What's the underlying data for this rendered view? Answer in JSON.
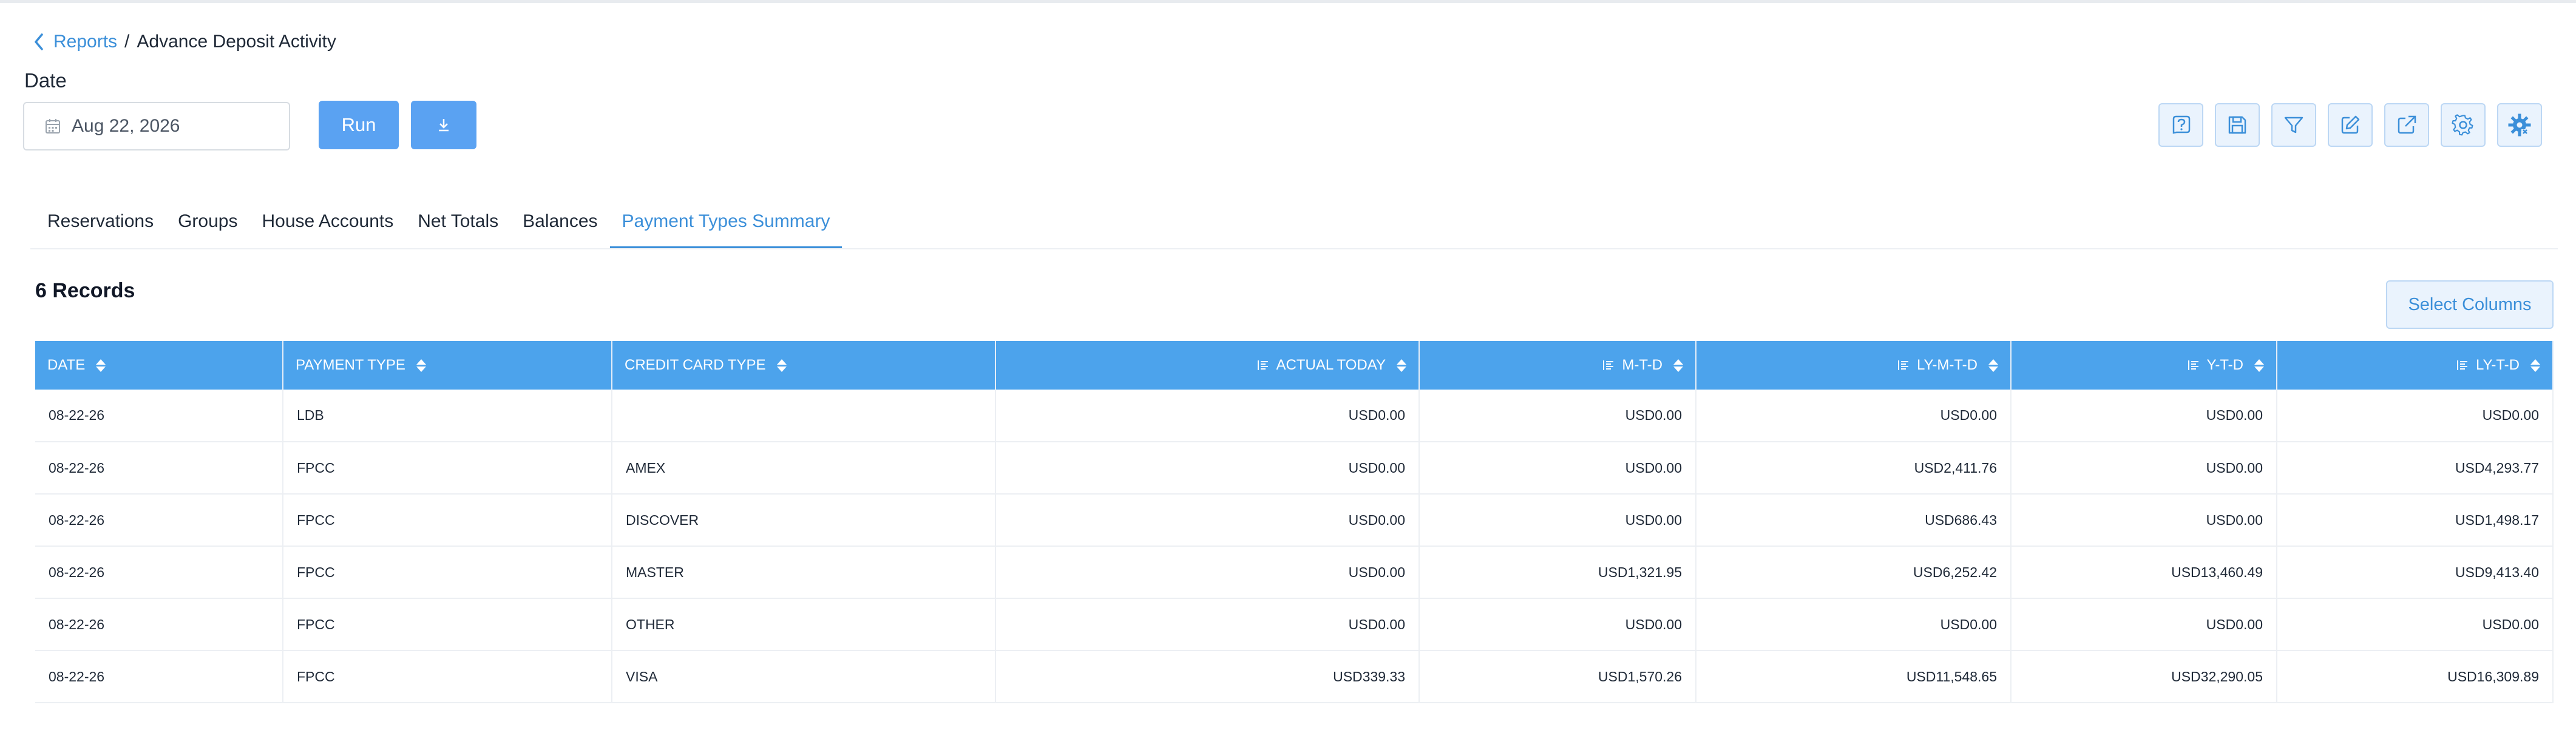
{
  "breadcrumb": {
    "parent": "Reports",
    "separator": "/",
    "current": "Advance Deposit Activity"
  },
  "filters": {
    "date_label": "Date",
    "date_value": "Aug 22, 2026"
  },
  "actions": {
    "run_label": "Run",
    "download_icon": "download-icon"
  },
  "toolbar_icons": [
    "help-icon",
    "save-icon",
    "filter-icon",
    "edit-icon",
    "export-icon",
    "settings-icon",
    "advanced-settings-icon"
  ],
  "tabs": [
    {
      "label": "Reservations"
    },
    {
      "label": "Groups"
    },
    {
      "label": "House Accounts"
    },
    {
      "label": "Net Totals"
    },
    {
      "label": "Balances"
    },
    {
      "label": "Payment Types Summary",
      "active": true
    }
  ],
  "records_label": "6 Records",
  "select_columns_label": "Select Columns",
  "table": {
    "columns": [
      "DATE",
      "PAYMENT TYPE",
      "CREDIT CARD TYPE",
      "ACTUAL TODAY",
      "M-T-D",
      "LY-M-T-D",
      "Y-T-D",
      "LY-T-D"
    ],
    "rows": [
      [
        "08-22-26",
        "LDB",
        "",
        "USD0.00",
        "USD0.00",
        "USD0.00",
        "USD0.00",
        "USD0.00"
      ],
      [
        "08-22-26",
        "FPCC",
        "AMEX",
        "USD0.00",
        "USD0.00",
        "USD2,411.76",
        "USD0.00",
        "USD4,293.77"
      ],
      [
        "08-22-26",
        "FPCC",
        "DISCOVER",
        "USD0.00",
        "USD0.00",
        "USD686.43",
        "USD0.00",
        "USD1,498.17"
      ],
      [
        "08-22-26",
        "FPCC",
        "MASTER",
        "USD0.00",
        "USD1,321.95",
        "USD6,252.42",
        "USD13,460.49",
        "USD9,413.40"
      ],
      [
        "08-22-26",
        "FPCC",
        "OTHER",
        "USD0.00",
        "USD0.00",
        "USD0.00",
        "USD0.00",
        "USD0.00"
      ],
      [
        "08-22-26",
        "FPCC",
        "VISA",
        "USD339.33",
        "USD1,570.26",
        "USD11,548.65",
        "USD32,290.05",
        "USD16,309.89"
      ]
    ]
  },
  "colors": {
    "accent": "#3b8fd9",
    "header_bg": "#4ca3ec",
    "button_bg": "#5aa2f2"
  }
}
